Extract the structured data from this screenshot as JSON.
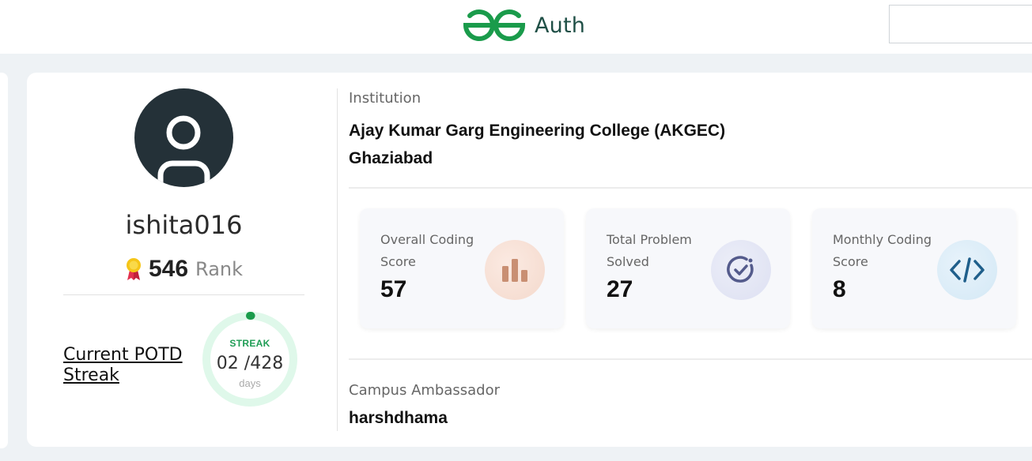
{
  "header": {
    "brand_name": "Auth",
    "logo_color": "#1a9b4b"
  },
  "profile": {
    "username": "ishita016",
    "rank_value": "546",
    "rank_label": "Rank"
  },
  "potd": {
    "link_line1": "Current POTD",
    "link_line2": "Streak",
    "streak_label": "STREAK",
    "streak_count": "02 /428",
    "streak_unit": "days",
    "streak_fraction": 0.0047,
    "ring_color": "#dff8ea",
    "progress_color": "#1a9b4b"
  },
  "institution": {
    "label": "Institution",
    "name_line1": "Ajay Kumar Garg Engineering College (AKGEC)",
    "name_line2": "Ghaziabad"
  },
  "stats": [
    {
      "label": "Overall Coding Score",
      "value": "57",
      "icon": "bar-chart-icon"
    },
    {
      "label": "Total Problem Solved",
      "value": "27",
      "icon": "check-circle-icon"
    },
    {
      "label": "Monthly Coding Score",
      "value": "8",
      "icon": "code-icon"
    }
  ],
  "ambassador": {
    "label": "Campus Ambassador",
    "name": "harshdhama"
  }
}
